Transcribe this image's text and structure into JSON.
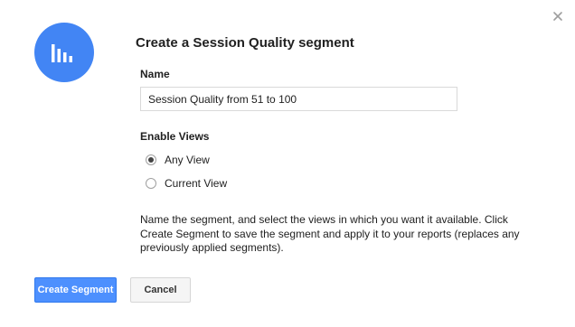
{
  "dialog": {
    "title": "Create a Session Quality segment",
    "close_icon": "close-icon",
    "avatar_icon": "bar-chart-icon",
    "accent_color": "#4285f4"
  },
  "name_field": {
    "label": "Name",
    "value": "Session Quality from 51 to 100"
  },
  "views": {
    "label": "Enable Views",
    "options": [
      {
        "label": "Any View",
        "selected": true
      },
      {
        "label": "Current View",
        "selected": false
      }
    ]
  },
  "help_text": "Name the segment, and select the views in which you want it available. Click Create Segment to save the segment and apply it to your reports (replaces any previously applied segments).",
  "buttons": {
    "create": "Create Segment",
    "cancel": "Cancel",
    "primary_color": "#4d90fe"
  }
}
